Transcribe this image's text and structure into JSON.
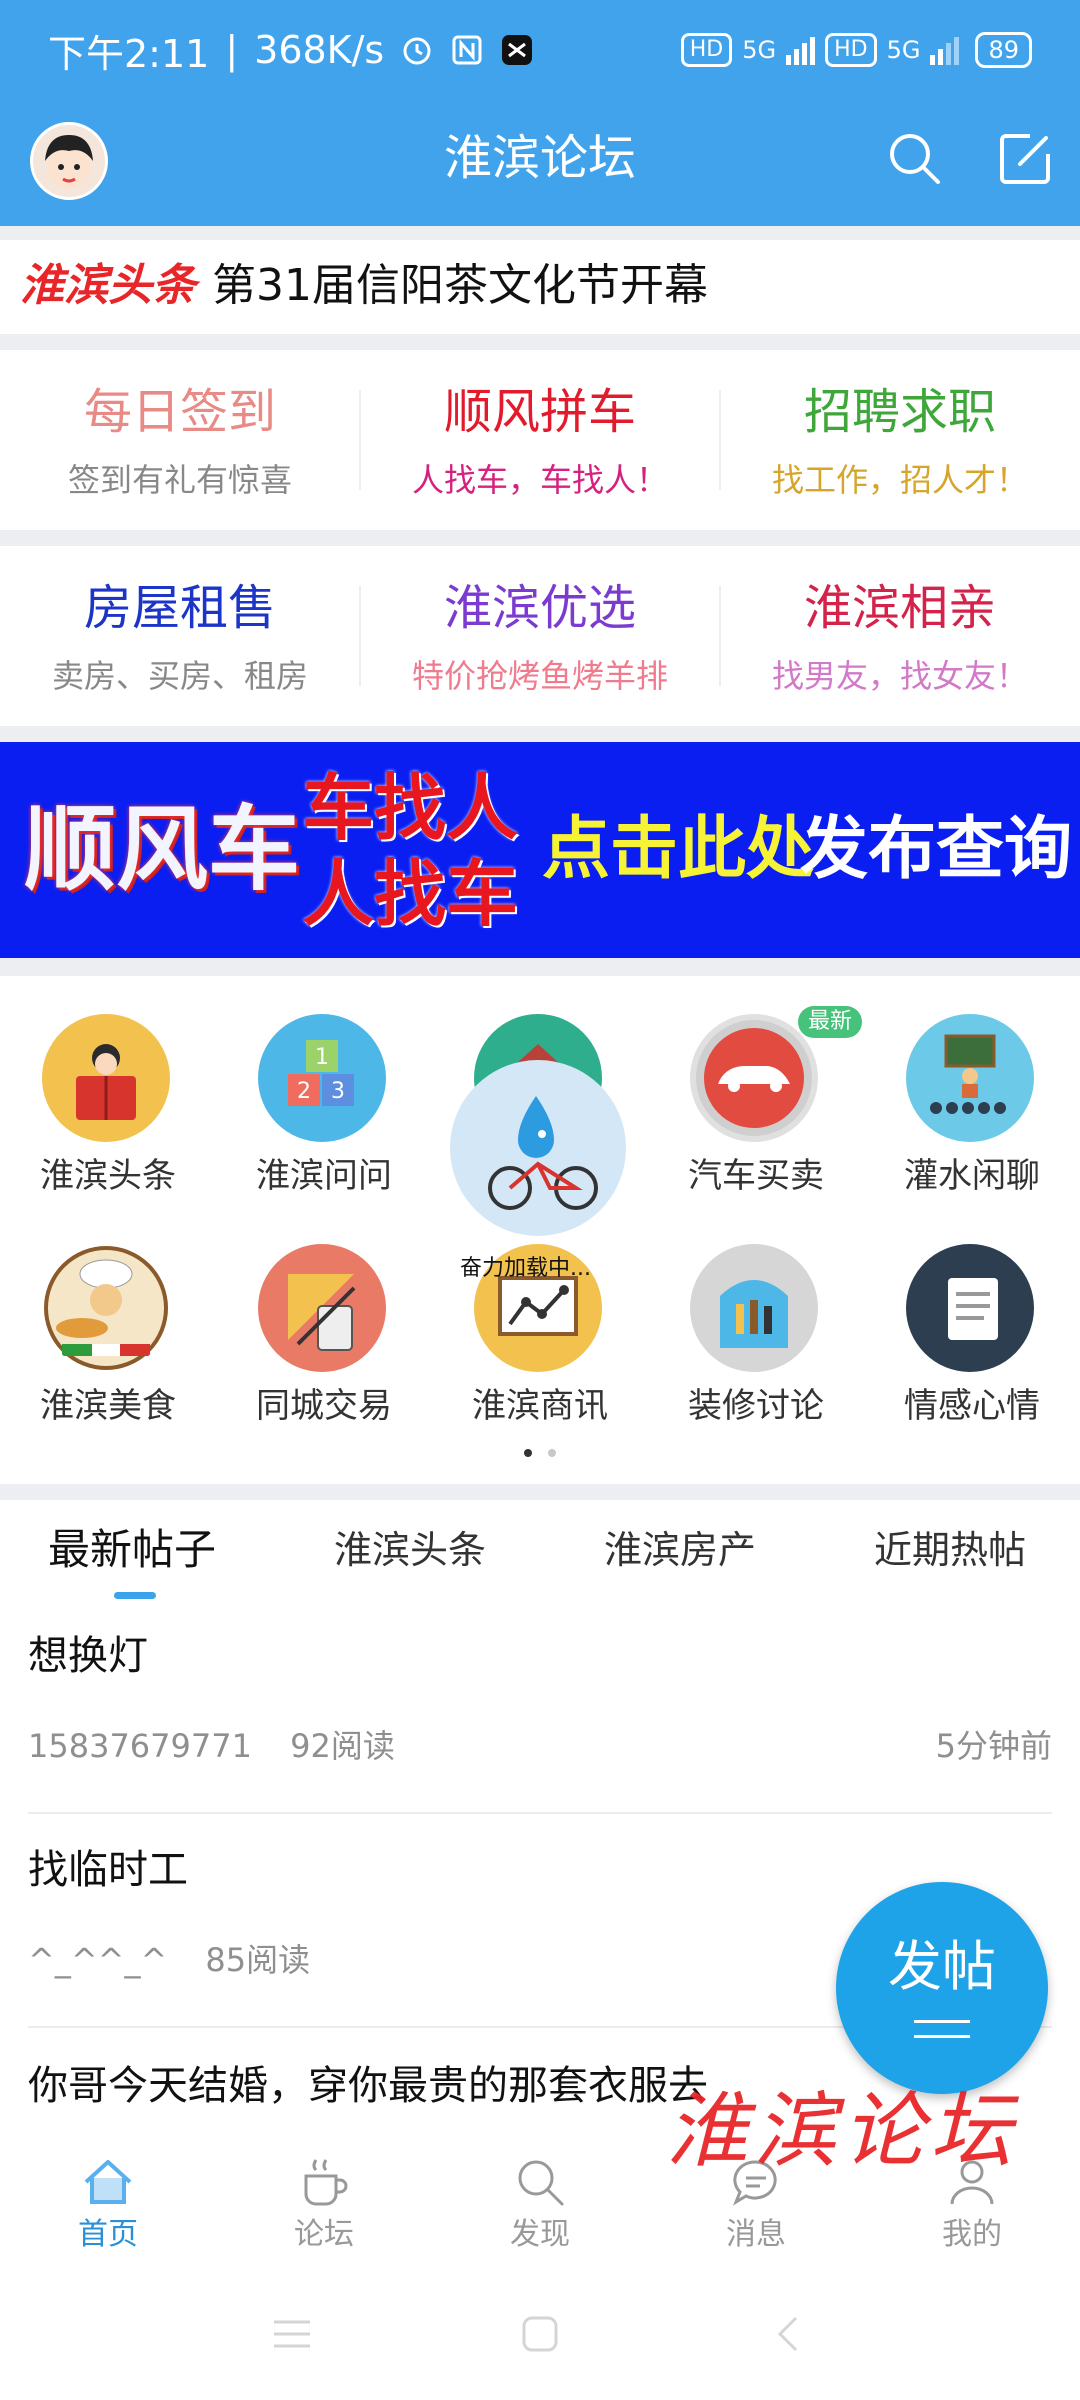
{
  "status_bar": {
    "time": "下午2:11",
    "speed": "368K/s",
    "sim1_label": "HD",
    "sim1_net": "5G",
    "sim2_label": "HD",
    "sim2_net": "5G",
    "battery": "89"
  },
  "header": {
    "title": "淮滨论坛"
  },
  "headline": {
    "brand": "淮滨头条",
    "text": "第31届信阳茶文化节开幕"
  },
  "quick_links_row1": [
    {
      "title": "每日签到",
      "subtitle": "签到有礼有惊喜",
      "title_color": "#E88A86",
      "subtitle_color": "#888888"
    },
    {
      "title": "顺风拼车",
      "subtitle": "人找车，车找人！",
      "title_color": "#E11B2B",
      "subtitle_color": "#D6217E"
    },
    {
      "title": "招聘求职",
      "subtitle": "找工作，招人才！",
      "title_color": "#3FA63A",
      "subtitle_color": "#D6A52A"
    }
  ],
  "quick_links_row2": [
    {
      "title": "房屋租售",
      "subtitle": "卖房、买房、租房",
      "title_color": "#1C34C8",
      "subtitle_color": "#888888"
    },
    {
      "title": "淮滨优选",
      "subtitle": "特价抢烤鱼烤羊排",
      "title_color": "#7B3BD1",
      "subtitle_color": "#F07B8E"
    },
    {
      "title": "淮滨相亲",
      "subtitle": "找男友，找女友！",
      "title_color": "#D4224A",
      "subtitle_color": "#D279C8"
    }
  ],
  "banner": {
    "big": "顺风车",
    "line1": "车找人",
    "line2": "人找车",
    "cta_yellow": "点击此处",
    "cta_white": "发布查询",
    "bg_color": "#0A1EF2"
  },
  "icon_grid": {
    "row1": [
      {
        "label": "淮滨头条",
        "icon": "reading-person-icon"
      },
      {
        "label": "淮滨问问",
        "icon": "abc-blocks-icon"
      },
      {
        "label": "",
        "icon": "house-icon"
      },
      {
        "label": "汽车买卖",
        "icon": "car-icon"
      },
      {
        "label": "灌水闲聊",
        "icon": "classroom-icon"
      }
    ],
    "row2": [
      {
        "label": "淮滨美食",
        "icon": "chef-pizza-icon"
      },
      {
        "label": "同城交易",
        "icon": "drafting-tools-icon"
      },
      {
        "label": "淮滨商讯",
        "icon": "chart-board-icon"
      },
      {
        "label": "装修讨论",
        "icon": "toolbag-icon"
      },
      {
        "label": "情感心情",
        "icon": "notepad-icon"
      }
    ],
    "badge_new": "最新",
    "loading_text": "奋力加载中..."
  },
  "tabs": [
    {
      "label": "最新帖子",
      "active": true
    },
    {
      "label": "淮滨头条"
    },
    {
      "label": "淮滨房产"
    },
    {
      "label": "近期热帖"
    }
  ],
  "posts": [
    {
      "title": "想换灯",
      "author": "15837679771",
      "reads": "92阅读",
      "time": "5分钟前"
    },
    {
      "title": "找临时工",
      "author": "^_^^_^",
      "reads": "85阅读",
      "time": ""
    },
    {
      "title": "你哥今天结婚，穿你最贵的那套衣服去",
      "author": "",
      "reads": "",
      "time": ""
    }
  ],
  "fab": {
    "label": "发帖"
  },
  "watermark": "淮滨论坛",
  "bottom_nav": [
    {
      "label": "首页",
      "icon": "home-icon",
      "active": true
    },
    {
      "label": "论坛",
      "icon": "coffee-cup-icon"
    },
    {
      "label": "发现",
      "icon": "search-icon"
    },
    {
      "label": "消息",
      "icon": "message-icon"
    },
    {
      "label": "我的",
      "icon": "person-icon"
    }
  ],
  "colors": {
    "primary": "#40A3EC",
    "accent": "#2B8FD8",
    "fab": "#1FA3E8"
  }
}
